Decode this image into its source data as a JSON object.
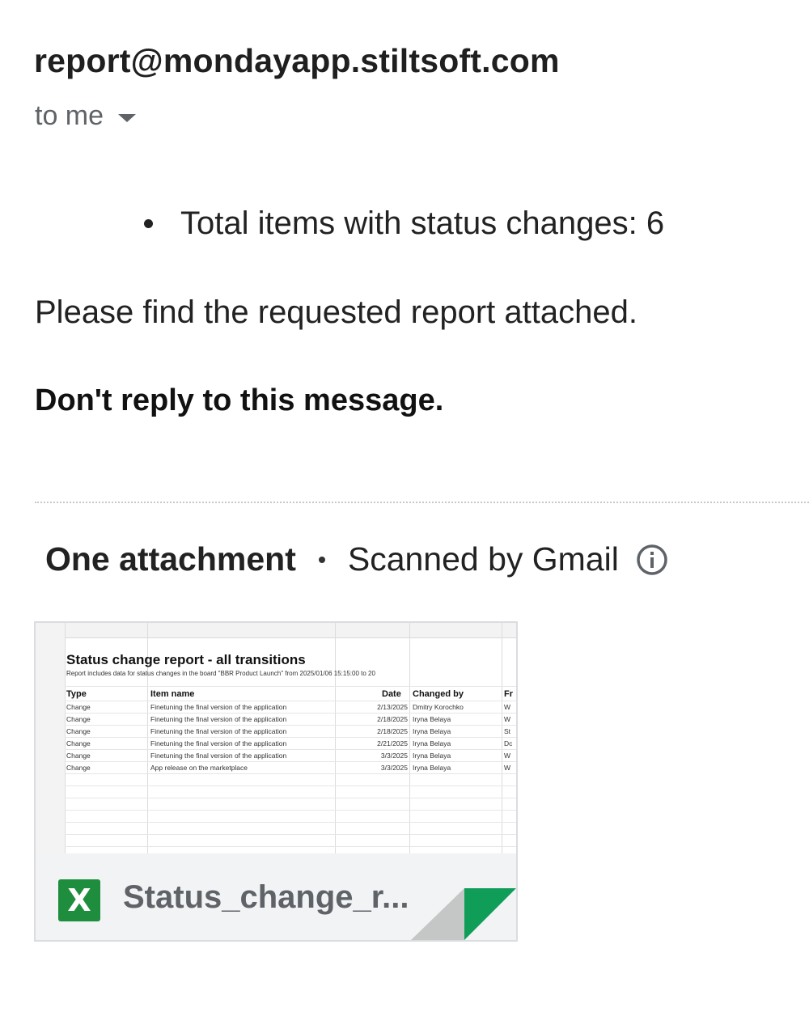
{
  "email": {
    "sender": "report@mondayapp.stiltsoft.com",
    "recipient_label": "to me",
    "bullets": [
      "Total items with status changes: 6"
    ],
    "body_line": "Please find the requested report attached.",
    "noreply": "Don't reply to this message."
  },
  "attachments": {
    "count_label": "One attachment",
    "scanned_label": "Scanned by Gmail",
    "file": {
      "name": "Status_change_r...",
      "icon": "excel-icon",
      "icon_letter": "X",
      "preview": {
        "title": "Status change report - all transitions",
        "subtitle": "Report includes data for status changes in the board \"BBR Product Launch\" from 2025/01/06 15:15:00 to 20",
        "headers": [
          "Type",
          "Item name",
          "Date",
          "Changed by",
          "Fr"
        ],
        "rows": [
          [
            "Change",
            "Finetuning the final version of the application",
            "2/13/2025",
            "Dmitry Korochko",
            "W"
          ],
          [
            "Change",
            "Finetuning the final version of the application",
            "2/18/2025",
            "Iryna Belaya",
            "W"
          ],
          [
            "Change",
            "Finetuning the final version of the application",
            "2/18/2025",
            "Iryna Belaya",
            "St"
          ],
          [
            "Change",
            "Finetuning the final version of the application",
            "2/21/2025",
            "Iryna Belaya",
            "Dc"
          ],
          [
            "Change",
            "Finetuning the final version of the application",
            "3/3/2025",
            "Iryna Belaya",
            "W"
          ],
          [
            "Change",
            "App release on the marketplace",
            "3/3/2025",
            "Iryna Belaya",
            "W"
          ]
        ]
      }
    }
  },
  "colors": {
    "excel_green": "#1e8e3e",
    "fold_green": "#0f9d58",
    "muted_text": "#5f6368"
  }
}
